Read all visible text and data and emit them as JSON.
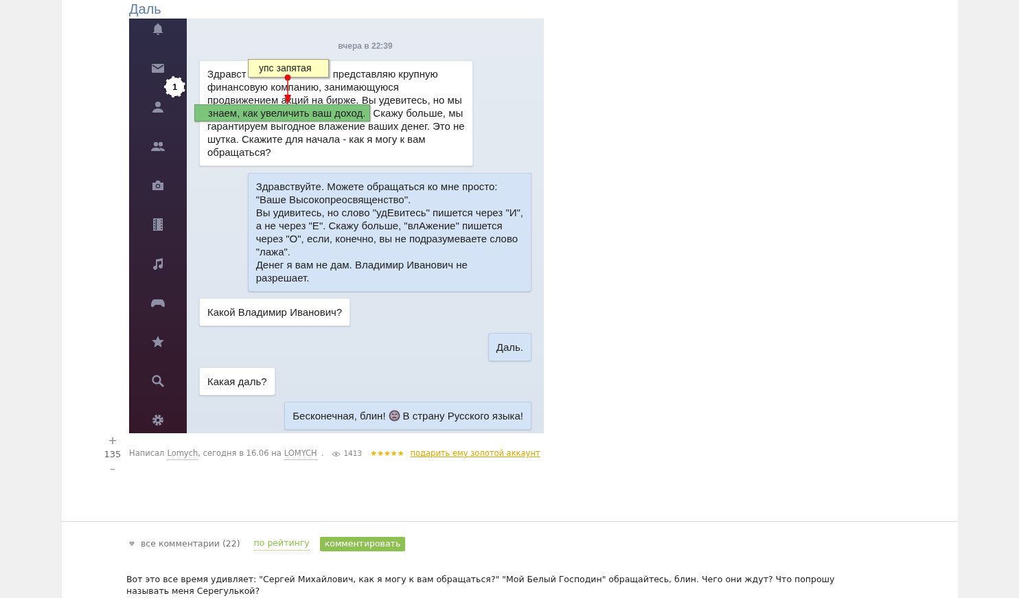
{
  "post": {
    "title": "Даль",
    "chat": {
      "timestamp": "вчера в 22:39",
      "messages": [
        {
          "kind": "incoming",
          "lines": [
            [
              "Здравст",
              {
                "kind": "covered"
              },
              "представляю крупную"
            ],
            "финансовую компанию, занимающуюся",
            "продвижением акций на бирже. Вы удевитесь, но мы",
            [
              {
                "kind": "highlighted",
                "text": "знаем, как увеличить ваш доход."
              },
              "Скажу больше, мы"
            ],
            "гарантируем выгодное влажение ваших денег. Это не",
            "шутка. Скажите для начала - как я могу к вам",
            "обращаться?"
          ]
        },
        {
          "kind": "outgoing",
          "lines": [
            "Здравствуйте. Можете обращаться ко мне просто:",
            "\"Ваше Высокопреосвященство\".",
            "Вы удивитесь, но слово \"удЕвитесь\" пишется через \"И\",",
            "а не через \"Е\". Скажу больше, \"влАжение\" пишется",
            "через \"О\", если, конечно, вы не подразумеваете слово",
            "\"лажа\".",
            "Денег я вам не дам. Владимир Иванович не",
            "разрешает."
          ]
        },
        {
          "kind": "incoming",
          "lines": [
            "Какой Владимир Иванович?"
          ]
        },
        {
          "kind": "outgoing",
          "lines": [
            "Даль."
          ]
        },
        {
          "kind": "incoming",
          "lines": [
            "Какая даль?"
          ]
        },
        {
          "kind": "outgoing",
          "lines": [
            [
              "Бесконечная, блин!",
              {
                "kind": "emoji"
              },
              "В страну Русского языка!"
            ]
          ]
        }
      ],
      "annotation": {
        "note": "упс запятая",
        "marker": "1"
      }
    },
    "rating": {
      "plus": "+",
      "score": "135",
      "minus": "–"
    },
    "meta": {
      "prefix": "Написал",
      "author": "Lomych",
      "middle": ", сегодня в 16.06 на",
      "community": "LOMYCH",
      "dot": ".",
      "views": "1413",
      "stars": 5,
      "gift_link": "подарить ему золотой аккаунт"
    }
  },
  "comments_bar": {
    "all": "все комментарии (22)",
    "sort": "по рейтингу",
    "button": "комментировать"
  },
  "comment": {
    "text": "Вот это все время удивляет: \"Сергей Михайлович, как я могу к вам обращаться?\" \"Мой Белый Господин\" обращайтесь, блин. Чего они ждут? Что попрошу называть меня Серегулькой?"
  }
}
